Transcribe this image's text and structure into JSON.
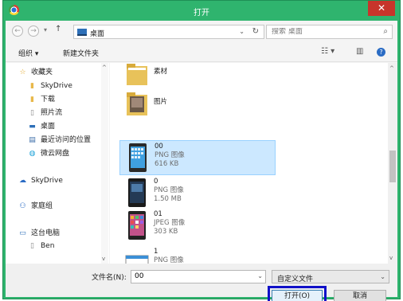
{
  "window": {
    "title": "打开",
    "close_glyph": "✕"
  },
  "address": {
    "back_glyph": "←",
    "forward_glyph": "→",
    "recent_glyph": "▾",
    "up_glyph": "↑",
    "breadcrumb": "桌面",
    "dropdown_glyph": "⌄",
    "refresh_glyph": "↻",
    "search_placeholder": "搜索 桌面",
    "search_glyph": "⌕"
  },
  "toolbar": {
    "organize_label": "组织 ▾",
    "new_folder_label": "新建文件夹",
    "view_glyph": "☷ ▾",
    "preview_glyph": "▥",
    "help_glyph": "?"
  },
  "nav": {
    "items": [
      {
        "label": "收藏夹",
        "icon": "star-icon",
        "glyph": "☆"
      },
      {
        "label": "SkyDrive",
        "icon": "folder-icon",
        "glyph": "▮"
      },
      {
        "label": "下载",
        "icon": "download-folder-icon",
        "glyph": "▮"
      },
      {
        "label": "照片流",
        "icon": "document-icon",
        "glyph": "▯"
      },
      {
        "label": "桌面",
        "icon": "desktop-icon",
        "glyph": "▬"
      },
      {
        "label": "最近访问的位置",
        "icon": "recent-places-icon",
        "glyph": "▤"
      },
      {
        "label": "微云网盘",
        "icon": "cloud-icon",
        "glyph": "◍"
      },
      {
        "label": "SkyDrive",
        "icon": "skydrive-icon",
        "glyph": "☁"
      },
      {
        "label": "家庭组",
        "icon": "homegroup-icon",
        "glyph": "⚇"
      },
      {
        "label": "这台电脑",
        "icon": "computer-icon",
        "glyph": "▭"
      },
      {
        "label": "Ben",
        "icon": "user-icon",
        "glyph": "▯"
      }
    ],
    "scroll_up": "^",
    "scroll_down": "v"
  },
  "files": [
    {
      "name": "素材",
      "type": "",
      "size": "",
      "kind": "folder"
    },
    {
      "name": "图片",
      "type": "",
      "size": "",
      "kind": "folder-photo"
    },
    {
      "name": "00",
      "type": "PNG 图像",
      "size": "616 KB",
      "kind": "phone-blue"
    },
    {
      "name": "0",
      "type": "PNG 图像",
      "size": "1.50 MB",
      "kind": "phone-dark"
    },
    {
      "name": "01",
      "type": "JPEG 图像",
      "size": "303 KB",
      "kind": "phone-colorful"
    },
    {
      "name": "1",
      "type": "PNG 图像",
      "size": "",
      "kind": "screenshot"
    }
  ],
  "file_scroll": {
    "up": "^",
    "down": "v"
  },
  "bottom": {
    "filename_label": "文件名(N):",
    "filename_value": "00",
    "filename_drop": "⌄",
    "filter_value": "自定义文件",
    "filter_drop": "⌄",
    "open_label": "打开(O)",
    "cancel_label": "取消"
  },
  "colors": {
    "titlebar": "#2fb46e",
    "close": "#c7352b",
    "selection": "#cce8ff",
    "highlight_outline": "#1010c8"
  }
}
